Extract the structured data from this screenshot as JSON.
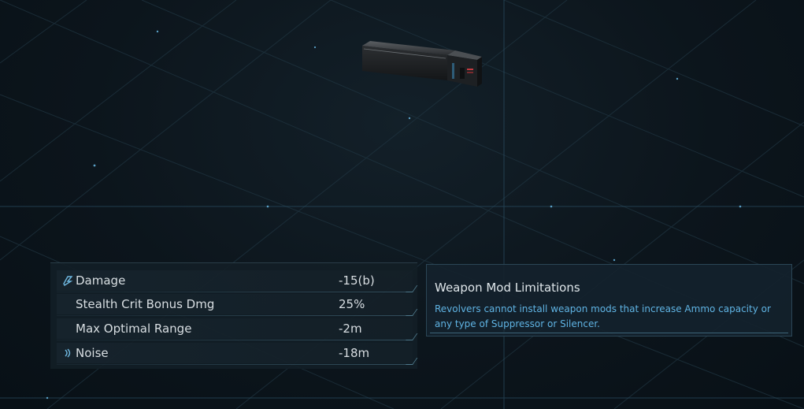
{
  "stats": [
    {
      "icon": "damage-icon",
      "name": "Damage",
      "value": "-15(b)"
    },
    {
      "icon": "",
      "name": "Stealth Crit Bonus Dmg",
      "value": "25%"
    },
    {
      "icon": "",
      "name": "Max Optimal Range",
      "value": "-2m"
    },
    {
      "icon": "noise-icon",
      "name": "Noise",
      "value": "-18m"
    }
  ],
  "limitations": {
    "title": "Weapon Mod Limitations",
    "body": "Revolvers cannot install weapon mods that increase Ammo capacity or any type of Suppressor or Silencer."
  },
  "colors": {
    "background": "#0b1218",
    "panel": "#121e26",
    "accent_blue": "#5fb3e3",
    "text": "#d8dee2"
  }
}
